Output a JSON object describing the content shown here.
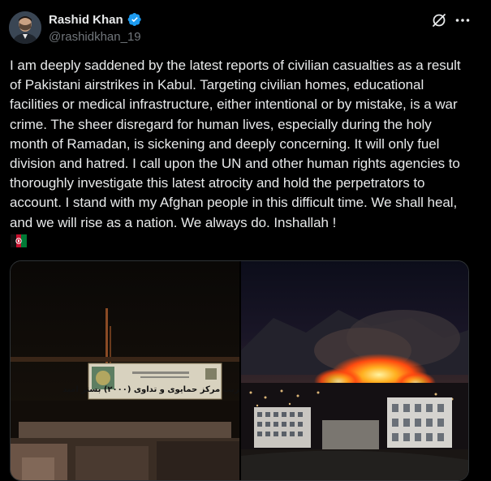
{
  "author": {
    "name": "Rashid Khan",
    "handle": "@rashidkhan_19",
    "verified_icon": "verified-badge-icon",
    "verified_color": "#1d9bf0"
  },
  "actions": {
    "grok_icon": "grok-icon",
    "more_icon": "more-options-icon"
  },
  "post": {
    "text": "I am deeply saddened by the latest reports of civilian casualties as a result of Pakistani airstrikes in Kabul. Targeting civilian homes, educational facilities or medical infrastructure, either intentional or by mistake, is a war crime. The sheer disregard for human lives, especially during the holy month of Ramadan, is sickening and deeply concerning. It will only fuel division and hatred. I call upon the UN and other human rights agencies to thoroughly investigate this latest atrocity and hold the perpetrators to account. I stand with my Afghan people in this difficult time. We shall heal, and we will rise as a nation. We always do. Inshallah !",
    "emoji": "afghanistan-flag-emoji"
  },
  "media": {
    "left_sign_text": "آمریت مرکز حمایوی و تداوی (۲۰۰۰) بستر امید",
    "left_icon": "building-photo",
    "right_icon": "fire-photo"
  },
  "colors": {
    "background": "#000000",
    "text": "#e7e9ea",
    "secondary": "#71767b",
    "border": "#2f3336"
  }
}
